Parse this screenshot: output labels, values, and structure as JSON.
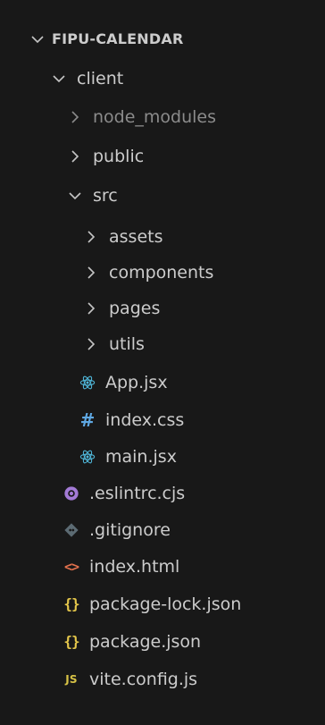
{
  "explorer": {
    "root": {
      "name": "FIPU-CALENDAR",
      "expanded": true
    },
    "client": {
      "name": "client",
      "expanded": true
    },
    "node_modules": {
      "name": "node_modules",
      "expanded": false
    },
    "public": {
      "name": "public",
      "expanded": false
    },
    "src": {
      "name": "src",
      "expanded": true
    },
    "assets": {
      "name": "assets",
      "expanded": false
    },
    "components": {
      "name": "components",
      "expanded": false
    },
    "pages": {
      "name": "pages",
      "expanded": false
    },
    "utils": {
      "name": "utils",
      "expanded": false
    },
    "files": {
      "app_jsx": {
        "name": "App.jsx",
        "icon": "react-icon"
      },
      "index_css": {
        "name": "index.css",
        "icon": "css-hash-icon"
      },
      "main_jsx": {
        "name": "main.jsx",
        "icon": "react-icon"
      },
      "eslintrc": {
        "name": ".eslintrc.cjs",
        "icon": "eslint-icon"
      },
      "gitignore": {
        "name": ".gitignore",
        "icon": "git-icon"
      },
      "index_html": {
        "name": "index.html",
        "icon": "html-icon"
      },
      "package_lock": {
        "name": "package-lock.json",
        "icon": "json-icon"
      },
      "package_json": {
        "name": "package.json",
        "icon": "json-icon"
      },
      "vite_config": {
        "name": "vite.config.js",
        "icon": "js-icon"
      }
    },
    "icon_text": {
      "js": "JS",
      "hash": "#",
      "braces": "{}",
      "html": "<>"
    },
    "colors": {
      "background": "#181818",
      "text": "#cccccc",
      "dimmed_text": "#8b8b8b",
      "chevron": "#c5c5c5",
      "react": "#4fb6d8",
      "css": "#5fa8e3",
      "eslint": "#a37ad6",
      "git": "#5c6b73",
      "html": "#e2714d",
      "json": "#e6c84b",
      "js": "#d7c246"
    }
  }
}
